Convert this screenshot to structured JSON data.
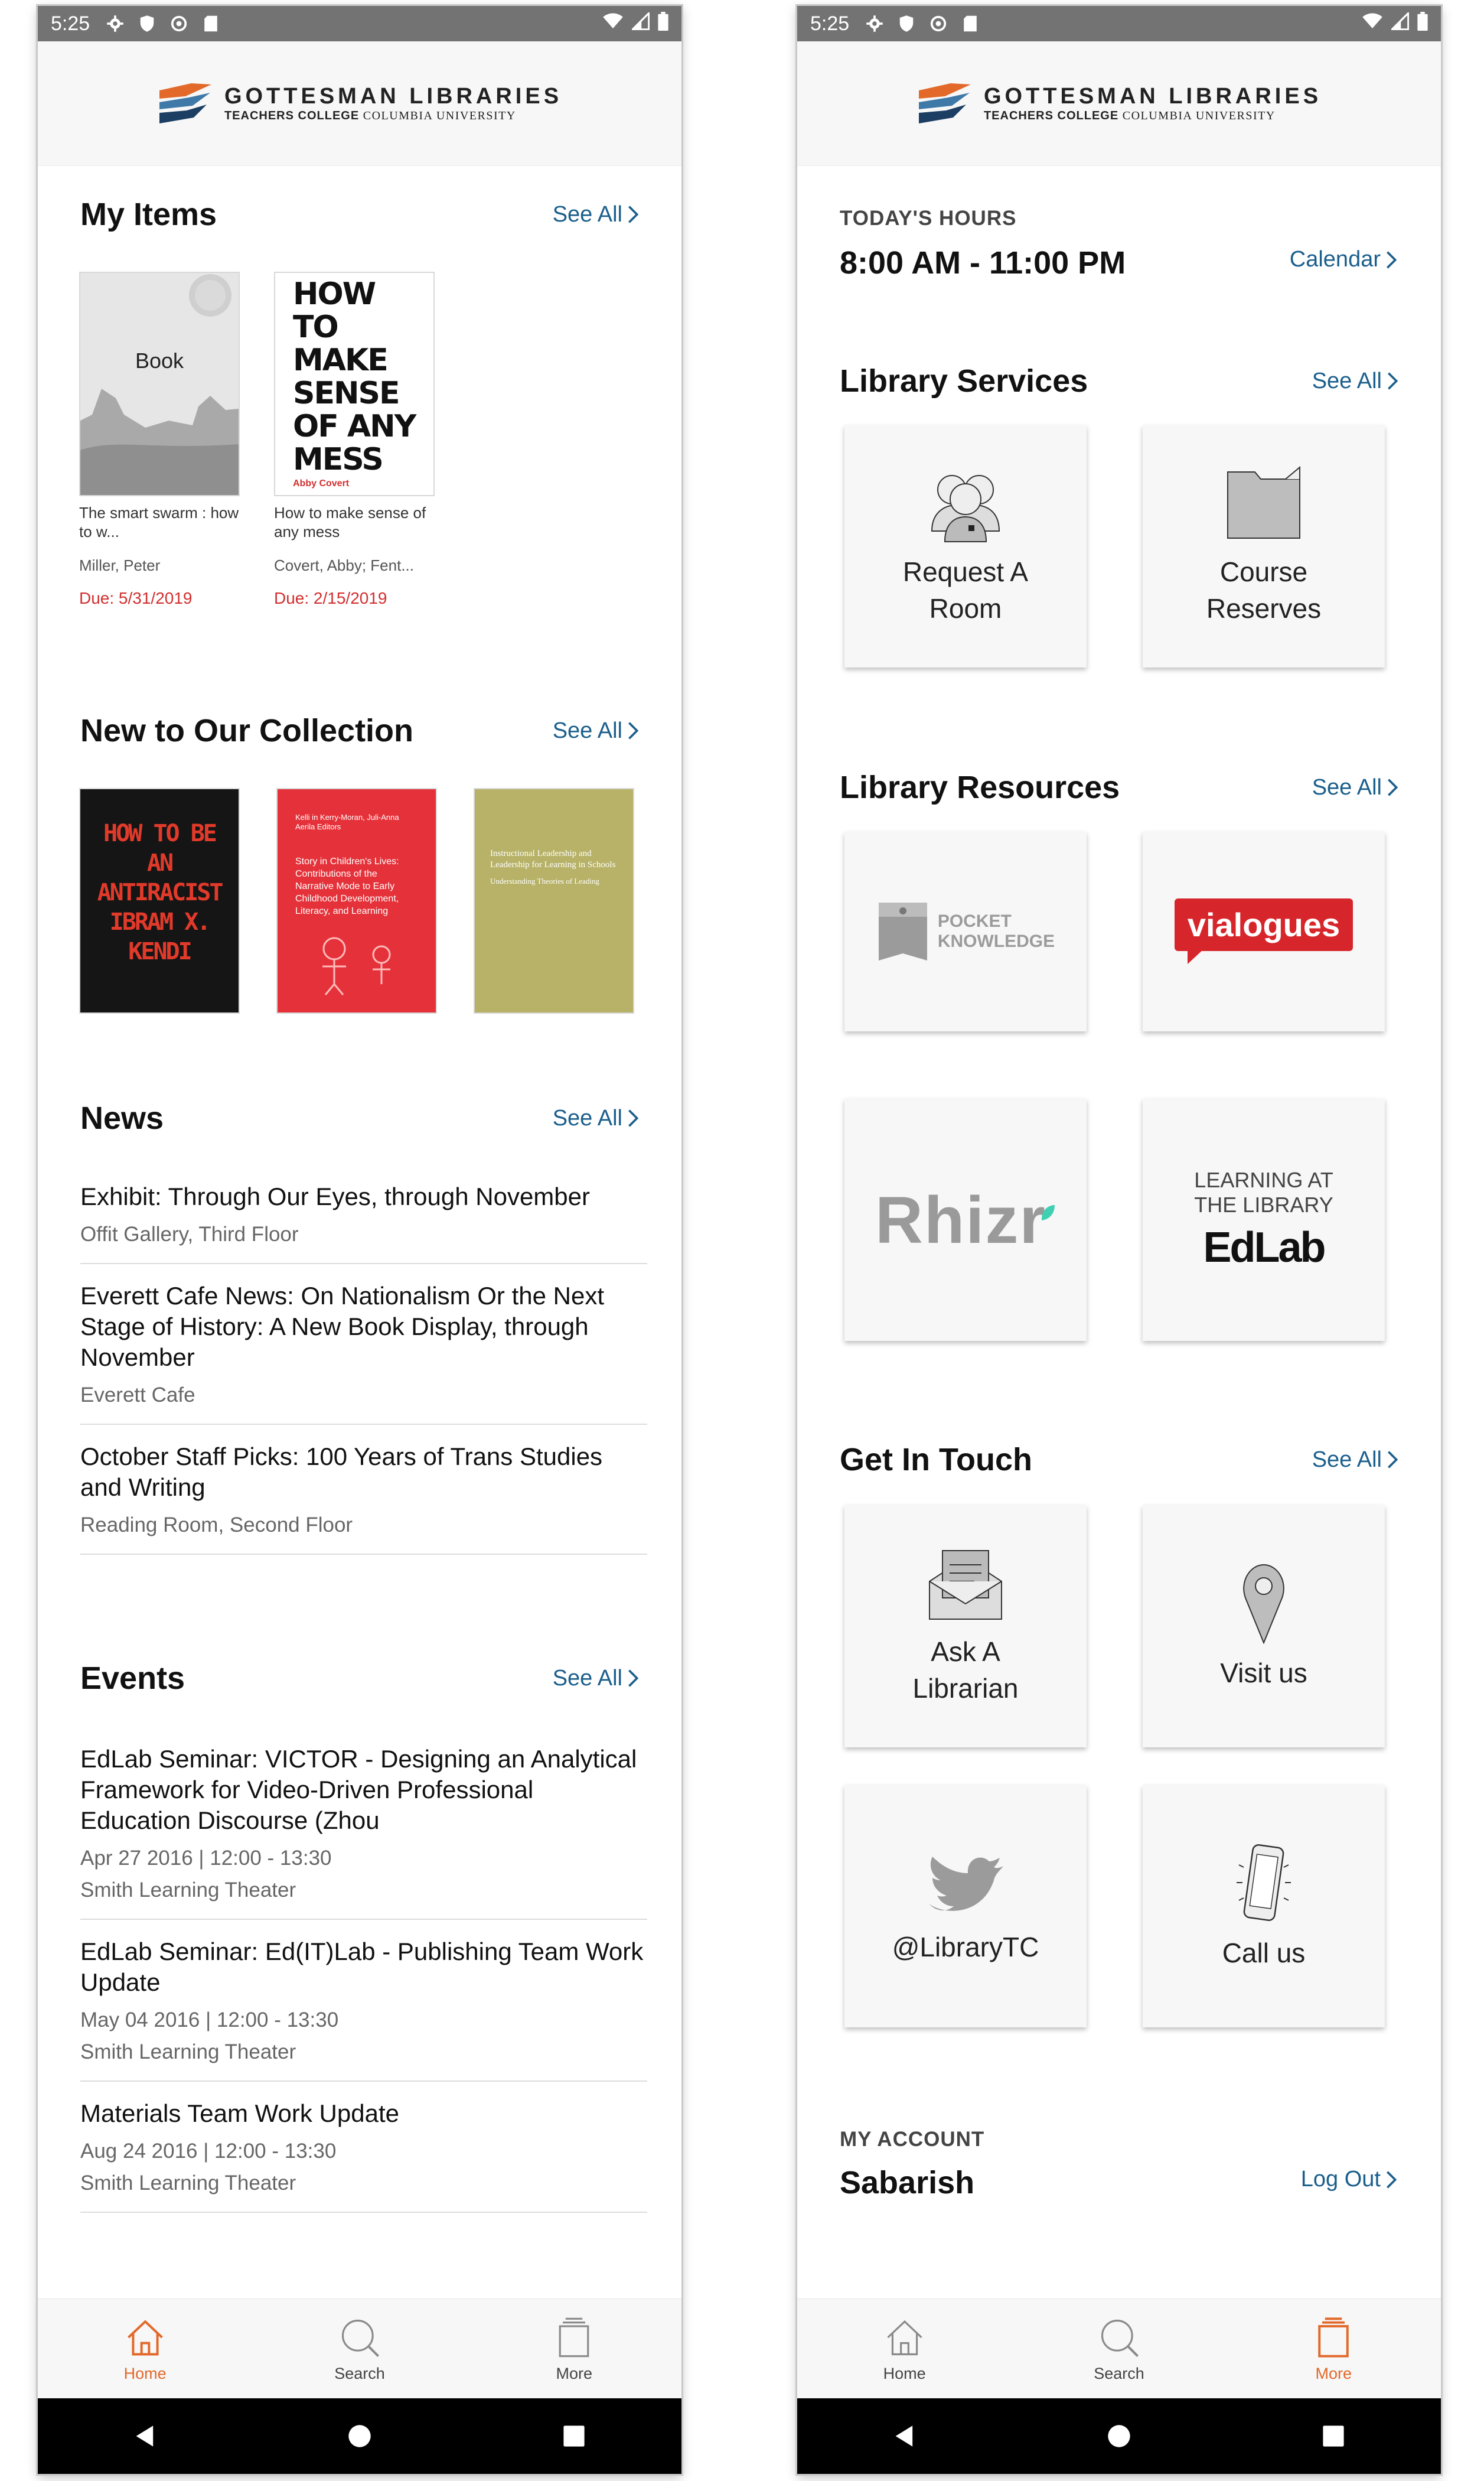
{
  "status": {
    "time": "5:25"
  },
  "logo": {
    "line1": "GOTTESMAN LIBRARIES",
    "line2a": "TEACHERS COLLEGE",
    "line2b": "COLUMBIA UNIVERSITY"
  },
  "left": {
    "my_items": {
      "title": "My Items",
      "see_all": "See All",
      "items": [
        {
          "cover_label": "Book",
          "title": "The smart swarm : how to w...",
          "author": "Miller, Peter",
          "due": "Due: 5/31/2019"
        },
        {
          "cover_text": "HOW TO MAKE SENSE OF ANY MESS",
          "cover_author": "Abby Covert",
          "title": "How to make sense of any mess",
          "author": "Covert, Abby; Fent...",
          "due": "Due: 2/15/2019"
        }
      ]
    },
    "new_collection": {
      "title": "New to Our Collection",
      "see_all": "See All",
      "books": [
        {
          "cover_text": "HOW TO BE AN ANTIRACIST IBRAM X. KENDI",
          "bg": "#151515",
          "fg": "#e23a2a"
        },
        {
          "cover_text": "Story in Children's Lives: Contributions of the Narrative Mode to Early Childhood Development, Literacy, and Learning",
          "top": "Kelli in Kerry-Moran, Juli-Anna Aerila Editors",
          "bg": "#e5323a",
          "fg": "#ffffff"
        },
        {
          "cover_text": "Instructional Leadership and Leadership for Learning in Schools",
          "sub": "Understanding Theories of Leading",
          "bg": "#b7b267",
          "fg": "#ffffff"
        }
      ]
    },
    "news": {
      "title": "News",
      "see_all": "See All",
      "items": [
        {
          "title": "Exhibit:  Through Our Eyes, through November",
          "sub": "Offit Gallery, Third Floor"
        },
        {
          "title": "Everett Cafe News: On Nationalism Or the Next Stage of History: A New Book Display, through November",
          "sub": "Everett Cafe"
        },
        {
          "title": "October Staff Picks: 100 Years of Trans Studies and Writing",
          "sub": "Reading Room, Second Floor"
        }
      ]
    },
    "events": {
      "title": "Events",
      "see_all": "See All",
      "items": [
        {
          "title": "EdLab Seminar: VICTOR - Designing an Analytical Framework for Video-Driven Professional Education Discourse (Zhou",
          "date": "Apr 27 2016 | 12:00 - 13:30",
          "place": "Smith Learning Theater"
        },
        {
          "title": "EdLab Seminar: Ed(IT)Lab - Publishing Team Work Update",
          "date": "May 04 2016 | 12:00 - 13:30",
          "place": "Smith Learning Theater"
        },
        {
          "title": "Materials Team Work Update",
          "date": "Aug 24 2016 | 12:00 - 13:30",
          "place": "Smith Learning Theater"
        }
      ]
    },
    "tabs": [
      {
        "label": "Home",
        "icon": "home-icon"
      },
      {
        "label": "Search",
        "icon": "search-icon"
      },
      {
        "label": "More",
        "icon": "more-icon"
      }
    ],
    "active_tab": "Home"
  },
  "right": {
    "hours": {
      "label": "TODAY'S HOURS",
      "value": "8:00 AM - 11:00 PM",
      "calendar": "Calendar"
    },
    "services": {
      "title": "Library Services",
      "see_all": "See All",
      "tiles": [
        "Request A Room",
        "Course Reserves"
      ]
    },
    "resources": {
      "title": "Library Resources",
      "see_all": "See All",
      "tiles": {
        "pocket": [
          "POCKET",
          "KNOWLEDGE"
        ],
        "vialogues": "vialogues",
        "rhizr": "Rhizr",
        "edlab_top": [
          "LEARNING AT",
          "THE LIBRARY"
        ],
        "edlab": "EdLab"
      }
    },
    "contact": {
      "title": "Get In Touch",
      "see_all": "See All",
      "tiles": [
        "Ask A Librarian",
        "Visit us",
        "@LibraryTC",
        "Call us"
      ]
    },
    "account": {
      "label": "MY ACCOUNT",
      "name": "Sabarish",
      "logout": "Log Out"
    },
    "tabs": [
      {
        "label": "Home",
        "icon": "home-icon"
      },
      {
        "label": "Search",
        "icon": "search-icon"
      },
      {
        "label": "More",
        "icon": "more-icon"
      }
    ],
    "active_tab": "More"
  },
  "colors": {
    "accent": "#e2692a",
    "link": "#1b5f8c",
    "due": "#d32f2f",
    "vialogues": "#d7262b"
  }
}
